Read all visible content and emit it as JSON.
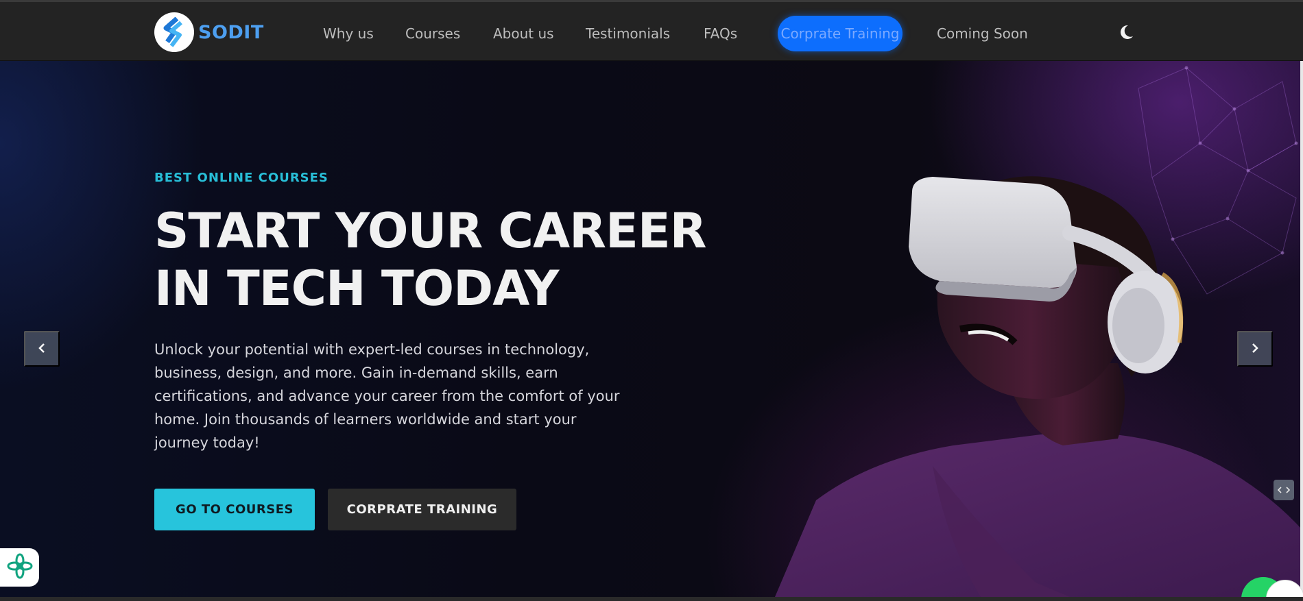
{
  "brand": {
    "name": "SODIT",
    "logo_icon": "sodit-logo-icon",
    "color": "#4d9ff0"
  },
  "nav": {
    "items": [
      {
        "label": "Why us"
      },
      {
        "label": "Courses"
      },
      {
        "label": "About us"
      },
      {
        "label": "Testimonials"
      },
      {
        "label": "FAQs"
      },
      {
        "label": "Corprate Training",
        "highlighted": true
      },
      {
        "label": "Coming Soon"
      }
    ],
    "theme_toggle_icon": "moon-icon"
  },
  "hero": {
    "eyebrow": "BEST ONLINE COURSES",
    "headline_line1": "START YOUR CAREER",
    "headline_line2": "IN TECH TODAY",
    "description": "Unlock your potential with expert-led courses in technology, business, design, and more. Gain in-demand skills, earn certifications, and advance your career from the comfort of your home. Join thousands of learners worldwide and start your journey today!",
    "primary_button": "GO TO COURSES",
    "secondary_button": "CORPRATE TRAINING",
    "prev_icon": "chevron-left-icon",
    "next_icon": "chevron-right-icon"
  },
  "widgets": {
    "chat_icon": "ai-flower-icon",
    "side_icon": "code-icon",
    "whatsapp_icon": "whatsapp-icon"
  },
  "colors": {
    "accent_cyan": "#27c4dc",
    "nav_bg": "#232323",
    "highlight_blue": "#0d6efd"
  }
}
